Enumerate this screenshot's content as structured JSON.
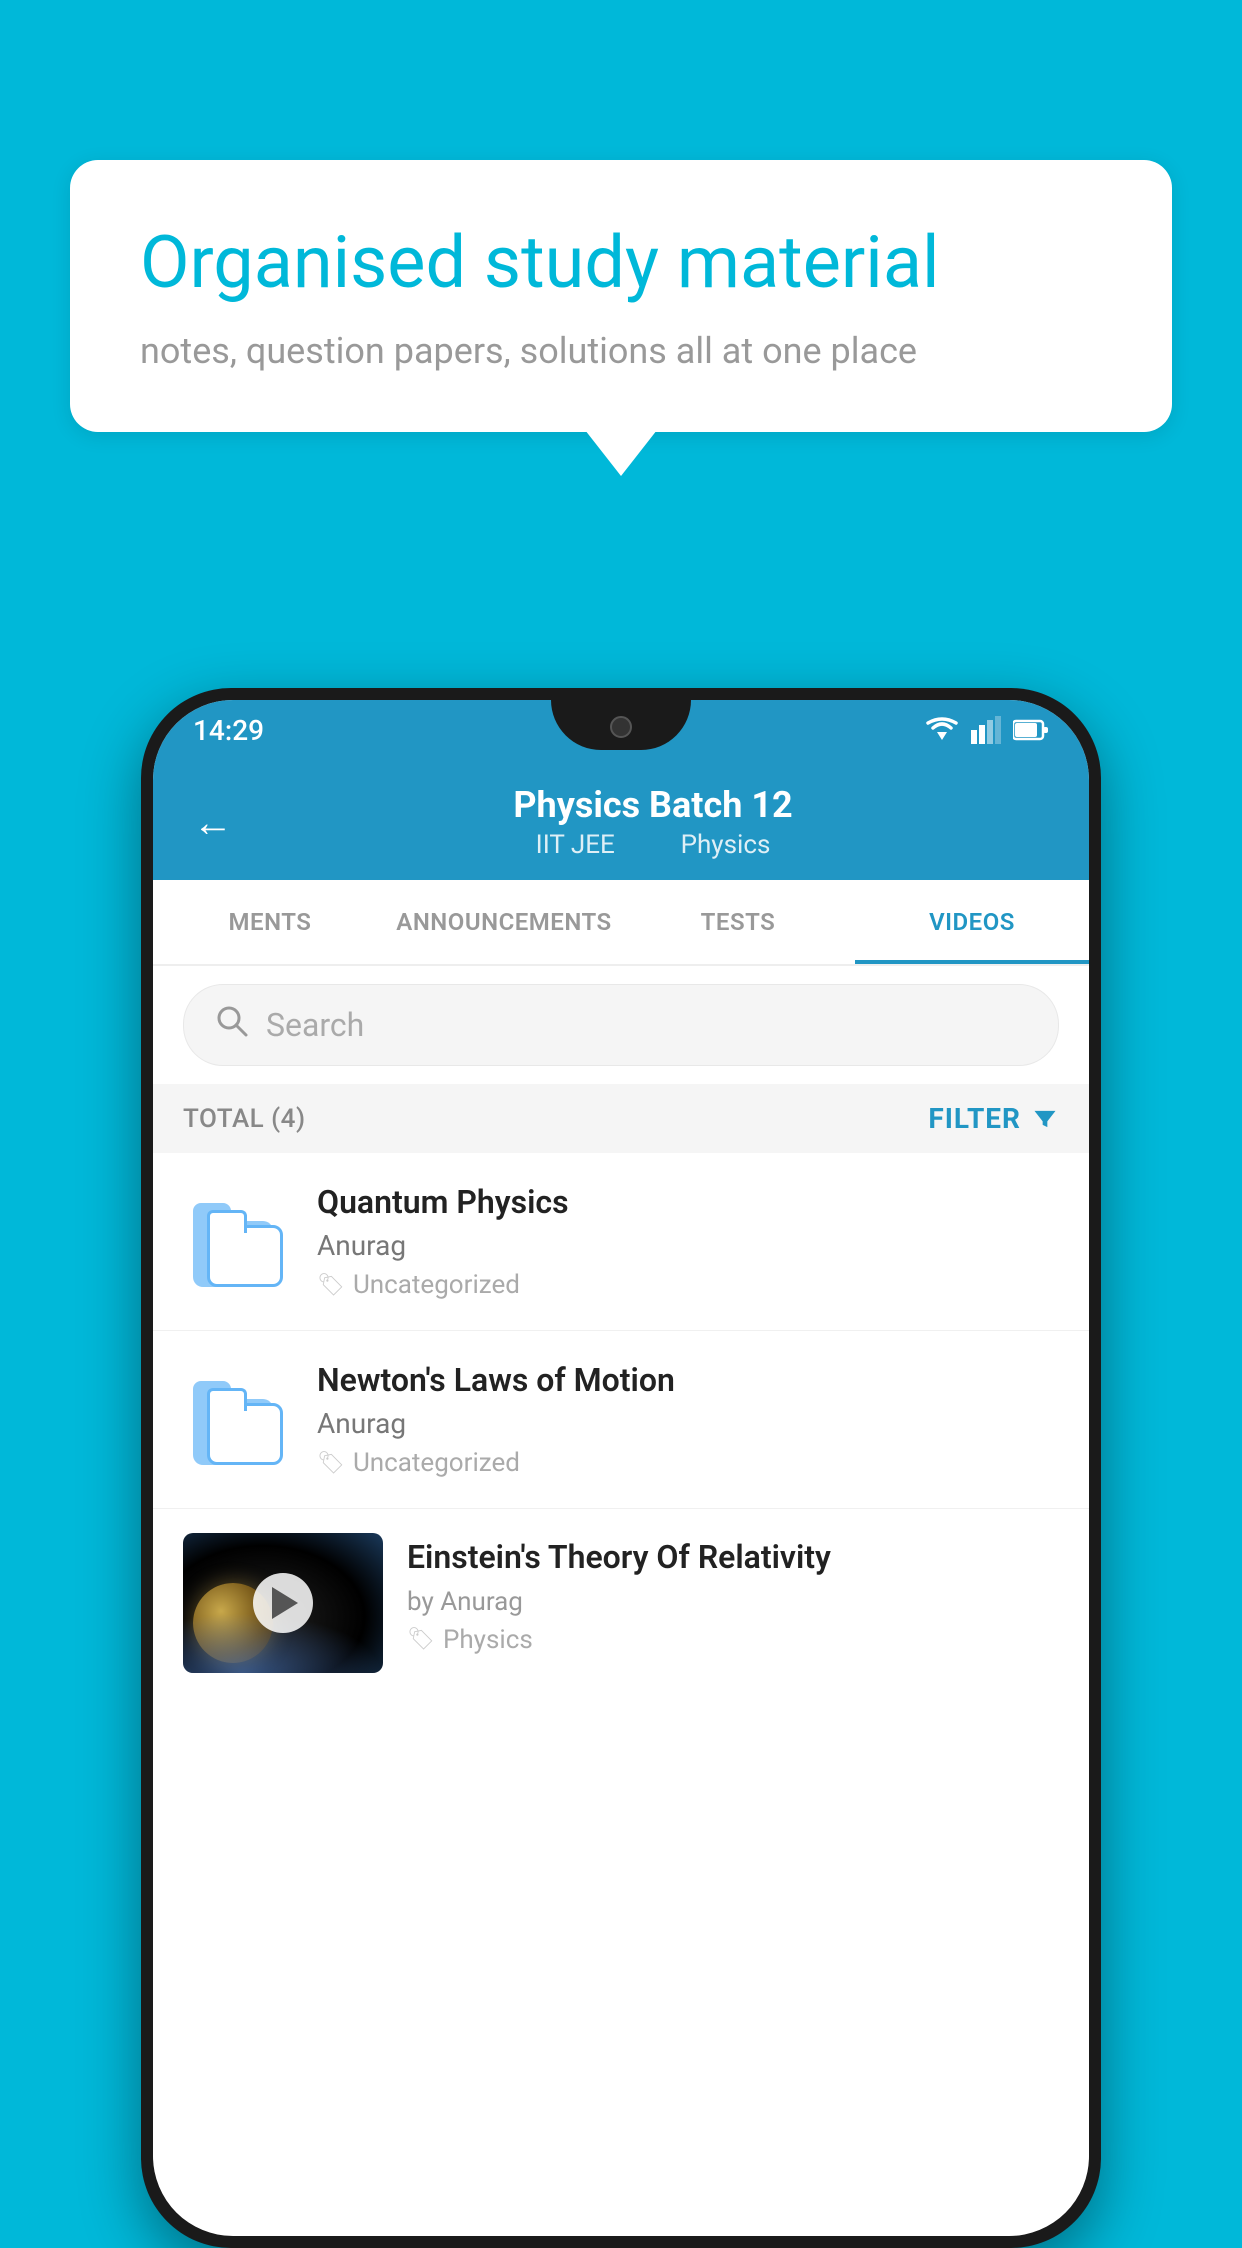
{
  "background_color": "#00b8d9",
  "speech_bubble": {
    "title": "Organised study material",
    "subtitle": "notes, question papers, solutions all at one place"
  },
  "status_bar": {
    "time": "14:29"
  },
  "app_header": {
    "title": "Physics Batch 12",
    "subtitle_left": "IIT JEE",
    "subtitle_right": "Physics",
    "back_label": "←"
  },
  "tabs": [
    {
      "label": "MENTS",
      "active": false
    },
    {
      "label": "ANNOUNCEMENTS",
      "active": false
    },
    {
      "label": "TESTS",
      "active": false
    },
    {
      "label": "VIDEOS",
      "active": true
    }
  ],
  "search": {
    "placeholder": "Search"
  },
  "filter_row": {
    "total_label": "TOTAL (4)",
    "filter_label": "FILTER"
  },
  "videos": [
    {
      "title": "Quantum Physics",
      "author": "Anurag",
      "tag": "Uncategorized",
      "has_thumb": false
    },
    {
      "title": "Newton's Laws of Motion",
      "author": "Anurag",
      "tag": "Uncategorized",
      "has_thumb": false
    },
    {
      "title": "Einstein's Theory Of Relativity",
      "author": "by Anurag",
      "tag": "Physics",
      "has_thumb": true
    }
  ]
}
